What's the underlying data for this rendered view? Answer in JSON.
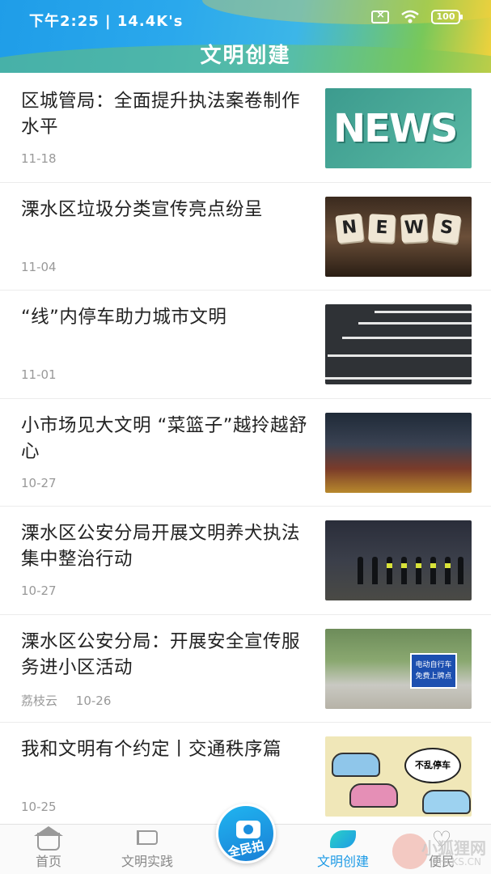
{
  "status_bar": {
    "time": "下午2:25 | 14.4K's",
    "battery": "100"
  },
  "header": {
    "title": "文明创建"
  },
  "articles": [
    {
      "title": "区城管局：全面提升执法案卷制作水平",
      "source": "",
      "date": "11-18",
      "thumb": "news-scrabble-green"
    },
    {
      "title": "溧水区垃圾分类宣传亮点纷呈",
      "source": "",
      "date": "11-04",
      "thumb": "news-tiles"
    },
    {
      "title": "“线”内停车助力城市文明",
      "source": "",
      "date": "11-01",
      "thumb": "parking-lines"
    },
    {
      "title": "小市场见大文明 “菜篮子”越拎越舒心",
      "source": "",
      "date": "10-27",
      "thumb": "market"
    },
    {
      "title": "溧水区公安分局开展文明养犬执法集中整治行动",
      "source": "",
      "date": "10-27",
      "thumb": "police-lineup"
    },
    {
      "title": "溧水区公安分局：开展安全宣传服务进小区活动",
      "source": "荔枝云",
      "date": "10-26",
      "thumb": "booth"
    },
    {
      "title": "我和文明有个约定丨交通秩序篇",
      "source": "",
      "date": "10-25",
      "thumb": "cartoon"
    }
  ],
  "thumb_text": {
    "news_big": "NEWS",
    "tiles": [
      "N",
      "E",
      "W",
      "S"
    ],
    "booth_sign": "电动自行车\n免费上牌点",
    "cartoon_bubble": "不乱停车"
  },
  "bottom_nav": {
    "items": [
      {
        "label": "首页",
        "icon": "home-icon",
        "active": false
      },
      {
        "label": "文明实践",
        "icon": "flag-icon",
        "active": false
      },
      {
        "label": "文明创建",
        "icon": "leaf-icon",
        "active": true
      },
      {
        "label": "便民",
        "icon": "heart-icon",
        "active": false
      }
    ],
    "center": {
      "label": "全民拍",
      "icon": "camera-icon"
    }
  },
  "watermark": {
    "text": "小狐狸网",
    "sub": "XHLKS.CN"
  },
  "colors": {
    "accent": "#1e9be6",
    "text": "#222222",
    "meta": "#999999"
  }
}
